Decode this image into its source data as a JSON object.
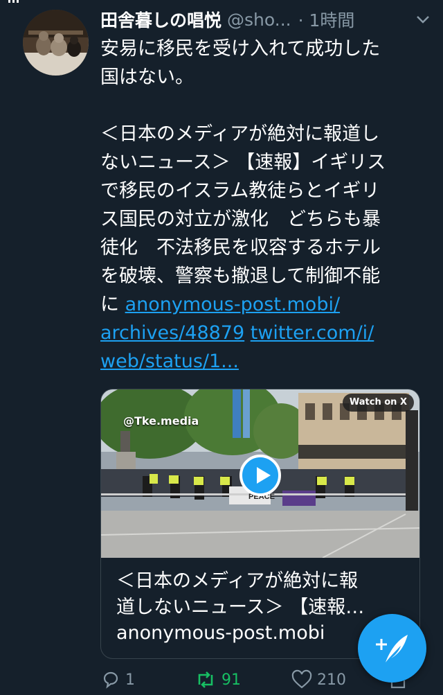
{
  "tweet": {
    "display_name": "田舎暮しの唱悦",
    "handle": "@sho...",
    "time": "· 1時間",
    "text_lines": [
      "安易に移民を受け入れて成功した",
      "国はない。",
      "",
      "＜日本のメディアが絶対に報道し",
      "ないニュース＞ 【速報】イギリス",
      "で移民のイスラム教徒らとイギリ",
      "ス国民の対立が激化　どちらも暴",
      "徒化　不法移民を収容するホテル",
      "を破壊、警察も撤退して制御不能"
    ],
    "text_last_prefix": "に ",
    "link1_part1": "anonymous-post.mobi/",
    "link1_part2": "archives/48879",
    "link2_part1": "twitter.com/i/",
    "link2_part2": "web/status/1..."
  },
  "card": {
    "watermark": "@Tke.media",
    "watch_badge": "Watch on X",
    "banner_text": "PEACE",
    "title": "＜日本のメディアが絶対に報道しないニュース＞ 【速報…",
    "title_line1": "＜日本のメディアが絶対に報",
    "title_line2": "道しないニュース＞ 【速報…",
    "domain": "anonymous-post.mobi"
  },
  "actions": {
    "reply_count": "1",
    "retweet_count": "91",
    "like_count": "210"
  },
  "colors": {
    "background": "#15202b",
    "link": "#1da1f2",
    "retweet_active": "#17bf63",
    "muted": "#8899a6"
  },
  "icons": [
    "chevron-down-icon",
    "reply-icon",
    "retweet-icon",
    "heart-icon",
    "share-icon",
    "compose-icon",
    "play-icon"
  ]
}
